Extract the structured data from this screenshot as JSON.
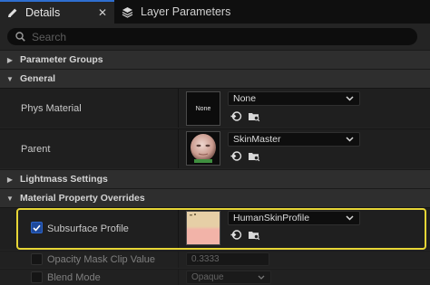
{
  "tabs": [
    {
      "label": "Details",
      "icon": "pencil-icon",
      "active": true,
      "close": "✕"
    },
    {
      "label": "Layer Parameters",
      "icon": "layers-icon",
      "active": false
    }
  ],
  "search": {
    "placeholder": "Search"
  },
  "categories": {
    "parameter_groups": {
      "label": "Parameter Groups",
      "expanded": false
    },
    "general": {
      "label": "General",
      "expanded": true
    },
    "lightmass": {
      "label": "Lightmass Settings",
      "expanded": false
    },
    "overrides": {
      "label": "Material Property Overrides",
      "expanded": true
    }
  },
  "properties": {
    "phys_material": {
      "label": "Phys Material",
      "thumbnail_text": "None",
      "value": "None"
    },
    "parent": {
      "label": "Parent",
      "value": "SkinMaster"
    },
    "subsurface_profile": {
      "label": "Subsurface Profile",
      "checked": true,
      "value": "HumanSkinProfile"
    },
    "opacity_mask": {
      "label": "Opacity Mask Clip Value",
      "checked": false,
      "value": "0.3333"
    },
    "blend_mode": {
      "label": "Blend Mode",
      "checked": false,
      "value": "Opaque"
    }
  },
  "colors": {
    "accent": "#2f6fd0",
    "highlight": "#e7d636",
    "checkbox": "#1e4a9c"
  }
}
